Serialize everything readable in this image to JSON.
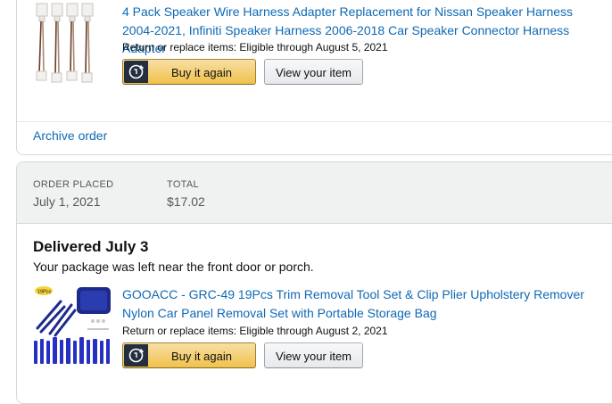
{
  "order1": {
    "item_title": "4 Pack Speaker Wire Harness Adapter Replacement for Nissan Speaker Harness 2004-2021, Infiniti Speaker Harness 2006-2018 Car Speaker Connector Harness Adapter",
    "return_text": "Return or replace items: Eligible through August 5, 2021",
    "buy_again_label": "Buy it again",
    "view_item_label": "View your item",
    "archive_label": "Archive order"
  },
  "order2": {
    "order_placed_label": "ORDER PLACED",
    "order_placed_value": "July 1, 2021",
    "total_label": "TOTAL",
    "total_value": "$17.02",
    "delivered_heading": "Delivered July 3",
    "delivery_note": "Your package was left near the front door or porch.",
    "item_title": "GOOACC - GRC-49 19Pcs Trim Removal Tool Set & Clip Plier Upholstery Remover Nylon Car Panel Removal Set with Portable Storage Bag",
    "return_text": "Return or replace items: Eligible through August 2, 2021",
    "buy_again_label": "Buy it again",
    "view_item_label": "View your item",
    "thumbnail_badge": "19Pcs"
  },
  "colors": {
    "link": "#0f69b4",
    "buy_button": "#f0c14b",
    "header_bg": "#f0f2f2",
    "tool_blue": "#2631c4"
  },
  "icons": [
    "buy-again-cycle-icon"
  ]
}
